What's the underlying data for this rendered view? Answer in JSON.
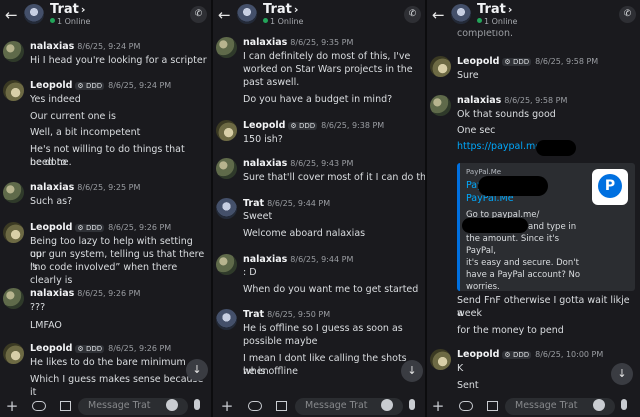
{
  "header": {
    "name": "Trat",
    "status": "1 Online",
    "back_icon": "back-arrow-icon",
    "call_icon": "phone-call-icon"
  },
  "composer": {
    "placeholder": "Message Trat",
    "icons": [
      "plus-icon",
      "gamepad-icon",
      "gift-icon",
      "emoji-icon",
      "microphone-icon"
    ]
  },
  "server_tag": "DDD",
  "panels": [
    {
      "messages": [
        {
          "author": "nalaxias",
          "time": "8/6/25, 9:24 PM",
          "lines": [
            "Hi I head you're looking for a scripter"
          ]
        },
        {
          "author": "Leopold",
          "tag": "DDD",
          "time": "8/6/25, 9:24 PM",
          "lines": [
            "Yes indeed",
            "Our current one is",
            "Well, a bit incompetent",
            "He's not willing to do things that need to",
            "be done."
          ]
        },
        {
          "author": "nalaxias",
          "time": "8/6/25, 9:25 PM",
          "lines": [
            "Such as?"
          ]
        },
        {
          "author": "Leopold",
          "tag": "DDD",
          "time": "8/6/25, 9:26 PM",
          "lines": [
            "Being too lazy to help with setting up",
            "our gun system, telling us that there is",
            "“no code involved” when there clearly is"
          ]
        },
        {
          "author": "nalaxias",
          "time": "8/6/25, 9:26 PM",
          "lines": [
            "???",
            "LMFAO"
          ]
        },
        {
          "author": "Leopold",
          "tag": "DDD",
          "time": "8/6/25, 9:26 PM",
          "lines": [
            "He likes to do the bare minimum",
            "Which I guess makes sense because it"
          ]
        }
      ]
    },
    {
      "messages": [
        {
          "author": "nalaxias",
          "time": "8/6/25, 9:35 PM",
          "lines": [
            "I can definitely do most of this, I've",
            "worked on Star Wars projects in the",
            "past aswell.",
            "Do you have a budget in mind?"
          ]
        },
        {
          "author": "Leopold",
          "tag": "DDD",
          "time": "8/6/25, 9:38 PM",
          "lines": [
            "150 ish?"
          ]
        },
        {
          "author": "nalaxias",
          "time": "8/6/25, 9:43 PM",
          "lines": [
            "Sure that'll cover most of it I can do that"
          ]
        },
        {
          "author": "Trat",
          "time": "8/6/25, 9:44 PM",
          "lines": [
            "Sweet",
            "Welcome aboard nalaxias"
          ]
        },
        {
          "author": "nalaxias",
          "time": "8/6/25, 9:44 PM",
          "lines": [
            ": D",
            "When do you want me to get started"
          ]
        },
        {
          "author": "Trat",
          "time": "8/6/25, 9:50 PM",
          "lines": [
            "He is offline so I guess as soon as",
            "possible maybe",
            "I mean I dont like calling the shots when",
            "he is offline"
          ]
        }
      ]
    },
    {
      "cut_top_line": "completion.",
      "messages": [
        {
          "author": "Leopold",
          "tag": "DDD",
          "time": "8/6/25, 9:58 PM",
          "lines": [
            "Sure"
          ]
        },
        {
          "author": "nalaxias",
          "time": "8/6/25, 9:58 PM",
          "lines": [
            "Ok that sounds good",
            "One sec",
            "https://paypal.me/"
          ]
        },
        {
          "author": "nalaxias",
          "time": "",
          "lines": [
            "Send FnF otherwise I gotta wait likje a",
            "week",
            "for the money to pend"
          ]
        },
        {
          "author": "Leopold",
          "tag": "DDD",
          "time": "8/6/25, 10:00 PM",
          "lines": [
            "K",
            "Sent"
          ]
        }
      ],
      "embed": {
        "site": "PayPal.Me",
        "title_left": "Pay",
        "title_right": "using",
        "title_line2": "PayPal.Me",
        "desc": [
          "Go to paypal.me/",
          "and type in",
          "the amount. Since it's PayPal,",
          "it's easy and secure. Don't",
          "have a PayPal account? No",
          "worries."
        ],
        "logo_letter": "P",
        "logo_icon": "paypal-logo-icon"
      }
    }
  ],
  "colors": {
    "background": "#1a1a1e",
    "link": "#00a8fc",
    "online": "#23a55a",
    "embed_accent": "#0070e0"
  }
}
